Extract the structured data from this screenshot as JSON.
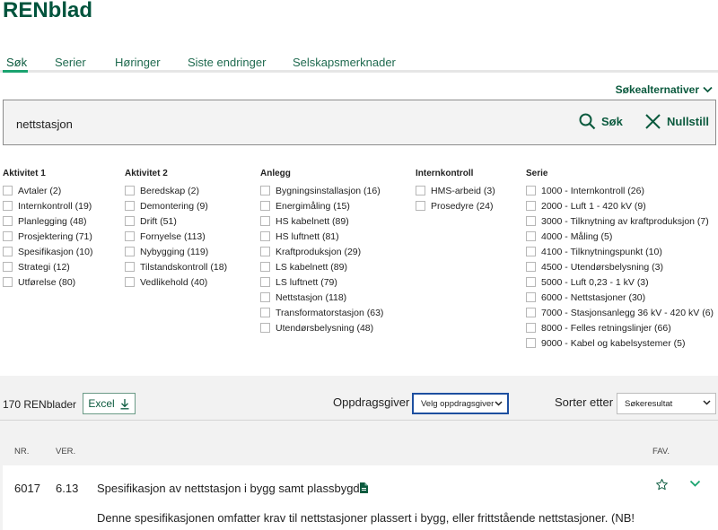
{
  "app": {
    "title": "RENblad"
  },
  "tabs": [
    {
      "label": "Søk",
      "active": true
    },
    {
      "label": "Serier"
    },
    {
      "label": "Høringer"
    },
    {
      "label": "Siste endringer"
    },
    {
      "label": "Selskapsmerknader"
    }
  ],
  "search": {
    "options_label": "Søkealternativer",
    "query": "nettstasjon",
    "search_label": "Søk",
    "reset_label": "Nullstill"
  },
  "filters": {
    "aktivitet1": {
      "title": "Aktivitet 1",
      "items": [
        "Avtaler (2)",
        "Internkontroll (19)",
        "Planlegging (48)",
        "Prosjektering (71)",
        "Spesifikasjon (10)",
        "Strategi (12)",
        "Utførelse (80)"
      ]
    },
    "aktivitet2": {
      "title": "Aktivitet 2",
      "items": [
        "Beredskap (2)",
        "Demontering (9)",
        "Drift (51)",
        "Fornyelse (113)",
        "Nybygging (119)",
        "Tilstandskontroll (18)",
        "Vedlikehold (40)"
      ]
    },
    "anlegg": {
      "title": "Anlegg",
      "items": [
        "Bygningsinstallasjon (16)",
        "Energimåling (15)",
        "HS kabelnett (89)",
        "HS luftnett (81)",
        "Kraftproduksjon (29)",
        "LS kabelnett (89)",
        "LS luftnett (79)",
        "Nettstasjon (118)",
        "Transformatorstasjon (63)",
        "Utendørsbelysning (48)"
      ]
    },
    "internkontroll": {
      "title": "Internkontroll",
      "items": [
        "HMS-arbeid (3)",
        "Prosedyre (24)"
      ]
    },
    "serie": {
      "title": "Serie",
      "items": [
        "1000 - Internkontroll (26)",
        "2000 - Luft 1 - 420 kV (9)",
        "3000 - Tilknytning av kraftproduksjon (7)",
        "4000 - Måling (5)",
        "4100 - Tilknytningspunkt (10)",
        "4500 - Utendørsbelysning (3)",
        "5000 - Luft 0,23 - 1 kV (3)",
        "6000 - Nettstasjoner (30)",
        "7000 - Stasjonsanlegg 36 kV - 420 kV (6)",
        "8000 - Felles retningslinjer (66)",
        "9000 - Kabel og kabelsystemer (5)"
      ]
    }
  },
  "results": {
    "count_label": "170 RENblader",
    "excel_label": "Excel",
    "client_label": "Oppdragsgiver",
    "client_value": "Velg oppdragsgiver",
    "sort_label": "Sorter etter",
    "sort_value": "Søkeresultat",
    "columns": {
      "nr": "NR.",
      "ver": "VER.",
      "fav": "FAV."
    },
    "items": [
      {
        "nr": "6017",
        "ver": "6.13",
        "title": "Spesifikasjon av nettstasjon i bygg samt plassbygd",
        "description": "Denne spesifikasjonen omfatter krav til nettstasjoner plassert i bygg, eller frittstående nettstasjoner. (NB!"
      }
    ]
  },
  "colors": {
    "brand": "#00543d",
    "accent": "#1aa36f",
    "band": "#f2f2f2",
    "select_border": "#1d4fa0"
  },
  "icons": [
    "chevron-down-icon",
    "search-icon",
    "close-icon",
    "download-icon",
    "document-icon",
    "star-icon"
  ]
}
